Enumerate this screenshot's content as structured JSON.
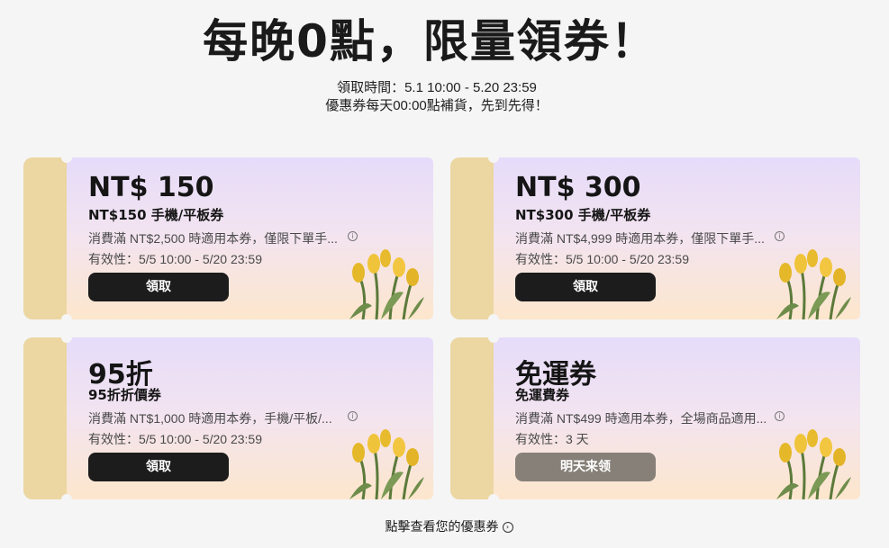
{
  "header": {
    "title": "每晚0點，限量領券！",
    "claim_time": "領取時間：5.1 10:00 - 5.20 23:59",
    "restock_note": "優惠券每天00:00點補貨，先到先得！"
  },
  "coupons": [
    {
      "amount": "NT$ 150",
      "name": "NT$150 手機/平板券",
      "condition": "消費滿 NT$2,500 時適用本券，僅限下單手...",
      "validity": "有效性：5/5 10:00 - 5/20 23:59",
      "button": "領取",
      "state": "active"
    },
    {
      "amount": "NT$ 300",
      "name": "NT$300 手機/平板券",
      "condition": "消費滿 NT$4,999 時適用本券，僅限下單手...",
      "validity": "有效性：5/5 10:00 - 5/20 23:59",
      "button": "領取",
      "state": "active"
    },
    {
      "amount": "95折",
      "name": "95折折價券",
      "condition": "消費滿 NT$1,000 時適用本券，手機/平板/...",
      "validity": "有效性：5/5 10:00 - 5/20 23:59",
      "button": "領取",
      "state": "active"
    },
    {
      "amount": "免運券",
      "name": "免運費券",
      "condition": "消費滿 NT$499 時適用本券，全場商品適用...",
      "validity": "有效性：3 天",
      "button": "明天来领",
      "state": "disabled"
    }
  ],
  "icons": {
    "info": "info-circle-icon",
    "arrow": "arrow-right-circle-icon",
    "decoration": "tulip-flowers-icon"
  },
  "colors": {
    "stub": "#ecd6a2",
    "button": "#1c1c1c",
    "button_disabled": "#878079"
  },
  "footer": {
    "link": "點擊查看您的優惠券"
  }
}
